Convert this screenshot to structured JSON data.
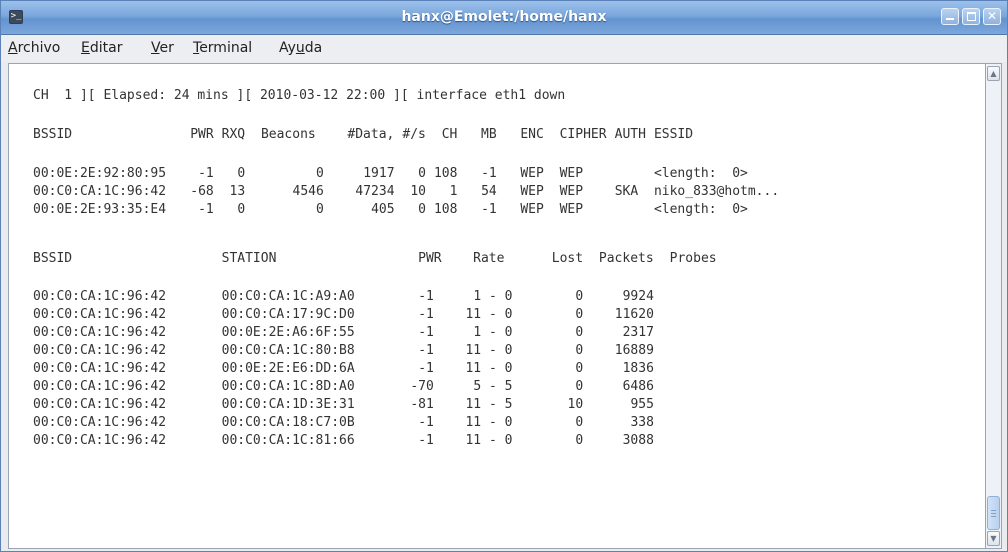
{
  "window": {
    "title": "hanx@Emolet:/home/hanx"
  },
  "menu": {
    "items": [
      {
        "pre": "",
        "mn": "A",
        "post": "rchivo"
      },
      {
        "pre": "",
        "mn": "E",
        "post": "ditar"
      },
      {
        "pre": "",
        "mn": "V",
        "post": "er"
      },
      {
        "pre": "",
        "mn": "T",
        "post": "erminal"
      },
      {
        "pre": "Ay",
        "mn": "u",
        "post": "da"
      }
    ]
  },
  "status_line": "CH  1 ][ Elapsed: 24 mins ][ 2010-03-12 22:00 ][ interface eth1 down",
  "ap_table": {
    "headers": {
      "bssid": "BSSID",
      "pwr": "PWR",
      "rxq": "RXQ",
      "beacons": "Beacons",
      "data": "#Data,",
      "rate": "#/s",
      "ch": "CH",
      "mb": "MB",
      "enc": "ENC",
      "cipher": "CIPHER",
      "auth": "AUTH",
      "essid": "ESSID"
    },
    "rows": [
      {
        "bssid": "00:0E:2E:92:80:95",
        "pwr": "-1",
        "rxq": "0",
        "beacons": "0",
        "data": "1917",
        "rate": "0",
        "ch": "108",
        "mb": "-1",
        "enc": "WEP",
        "cipher": "WEP",
        "auth": "",
        "essid": "<length:  0>"
      },
      {
        "bssid": "00:C0:CA:1C:96:42",
        "pwr": "-68",
        "rxq": "13",
        "beacons": "4546",
        "data": "47234",
        "rate": "10",
        "ch": "1",
        "mb": "54",
        "enc": "WEP",
        "cipher": "WEP",
        "auth": "SKA",
        "essid": "niko_833@hotm..."
      },
      {
        "bssid": "00:0E:2E:93:35:E4",
        "pwr": "-1",
        "rxq": "0",
        "beacons": "0",
        "data": "405",
        "rate": "0",
        "ch": "108",
        "mb": "-1",
        "enc": "WEP",
        "cipher": "WEP",
        "auth": "",
        "essid": "<length:  0>"
      }
    ]
  },
  "station_table": {
    "headers": {
      "bssid": "BSSID",
      "station": "STATION",
      "pwr": "PWR",
      "rate": "Rate",
      "lost": "Lost",
      "packets": "Packets",
      "probes": "Probes"
    },
    "rows": [
      {
        "bssid": "00:C0:CA:1C:96:42",
        "station": "00:C0:CA:1C:A9:A0",
        "pwr": "-1",
        "rate": "1 - 0",
        "lost": "0",
        "packets": "9924"
      },
      {
        "bssid": "00:C0:CA:1C:96:42",
        "station": "00:C0:CA:17:9C:D0",
        "pwr": "-1",
        "rate": "11 - 0",
        "lost": "0",
        "packets": "11620"
      },
      {
        "bssid": "00:C0:CA:1C:96:42",
        "station": "00:0E:2E:A6:6F:55",
        "pwr": "-1",
        "rate": "1 - 0",
        "lost": "0",
        "packets": "2317"
      },
      {
        "bssid": "00:C0:CA:1C:96:42",
        "station": "00:C0:CA:1C:80:B8",
        "pwr": "-1",
        "rate": "11 - 0",
        "lost": "0",
        "packets": "16889"
      },
      {
        "bssid": "00:C0:CA:1C:96:42",
        "station": "00:0E:2E:E6:DD:6A",
        "pwr": "-1",
        "rate": "11 - 0",
        "lost": "0",
        "packets": "1836"
      },
      {
        "bssid": "00:C0:CA:1C:96:42",
        "station": "00:C0:CA:1C:8D:A0",
        "pwr": "-70",
        "rate": "5 - 5",
        "lost": "0",
        "packets": "6486"
      },
      {
        "bssid": "00:C0:CA:1C:96:42",
        "station": "00:C0:CA:1D:3E:31",
        "pwr": "-81",
        "rate": "11 - 5",
        "lost": "10",
        "packets": "955"
      },
      {
        "bssid": "00:C0:CA:1C:96:42",
        "station": "00:C0:CA:18:C7:0B",
        "pwr": "-1",
        "rate": "11 - 0",
        "lost": "0",
        "packets": "338"
      },
      {
        "bssid": "00:C0:CA:1C:96:42",
        "station": "00:C0:CA:1C:81:66",
        "pwr": "-1",
        "rate": "11 - 0",
        "lost": "0",
        "packets": "3088"
      }
    ]
  },
  "icons": {
    "app": "terminal-icon",
    "minimize": "minimize-icon",
    "maximize": "maximize-icon",
    "close": "close-icon"
  },
  "colors": {
    "titlebar": "#7aa7dc",
    "terminal_bg": "#ffffff",
    "terminal_text": "#333333"
  }
}
